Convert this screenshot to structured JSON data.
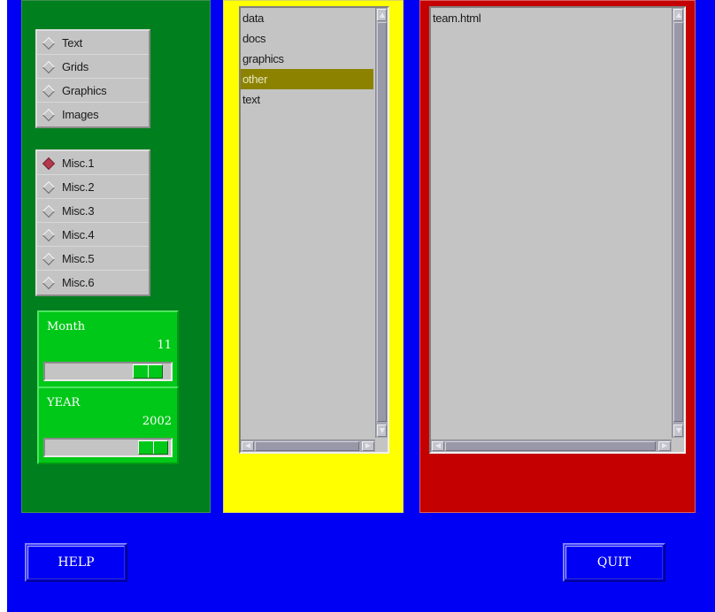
{
  "colors": {
    "background": "#0000f4",
    "left_panel": "#007f1f",
    "middle_panel": "#ffff00",
    "right_panel": "#c40000",
    "scale_box": "#00c818",
    "list_background": "#c4c4c4",
    "list_selected": "#8c8200",
    "radio_selected": "#b23a4e"
  },
  "left_panel": {
    "category_radios": [
      {
        "label": "Text",
        "selected": false
      },
      {
        "label": "Grids",
        "selected": false
      },
      {
        "label": "Graphics",
        "selected": false
      },
      {
        "label": "Images",
        "selected": false
      }
    ],
    "misc_radios": [
      {
        "label": "Misc.1",
        "selected": true
      },
      {
        "label": "Misc.2",
        "selected": false
      },
      {
        "label": "Misc.3",
        "selected": false
      },
      {
        "label": "Misc.4",
        "selected": false
      },
      {
        "label": "Misc.5",
        "selected": false
      },
      {
        "label": "Misc.6",
        "selected": false
      }
    ],
    "month_scale": {
      "title": "Month",
      "value": "11",
      "slider_fraction": 0.92
    },
    "year_scale": {
      "title": "YEAR",
      "value": "2002",
      "slider_fraction": 0.98
    }
  },
  "directory_list": {
    "items": [
      {
        "label": "data",
        "selected": false
      },
      {
        "label": "docs",
        "selected": false
      },
      {
        "label": "graphics",
        "selected": false
      },
      {
        "label": "other",
        "selected": true
      },
      {
        "label": "text",
        "selected": false
      }
    ]
  },
  "file_list": {
    "items": [
      {
        "label": "team.html",
        "selected": false
      }
    ]
  },
  "buttons": {
    "help_label": "HELP",
    "quit_label": "QUIT"
  }
}
